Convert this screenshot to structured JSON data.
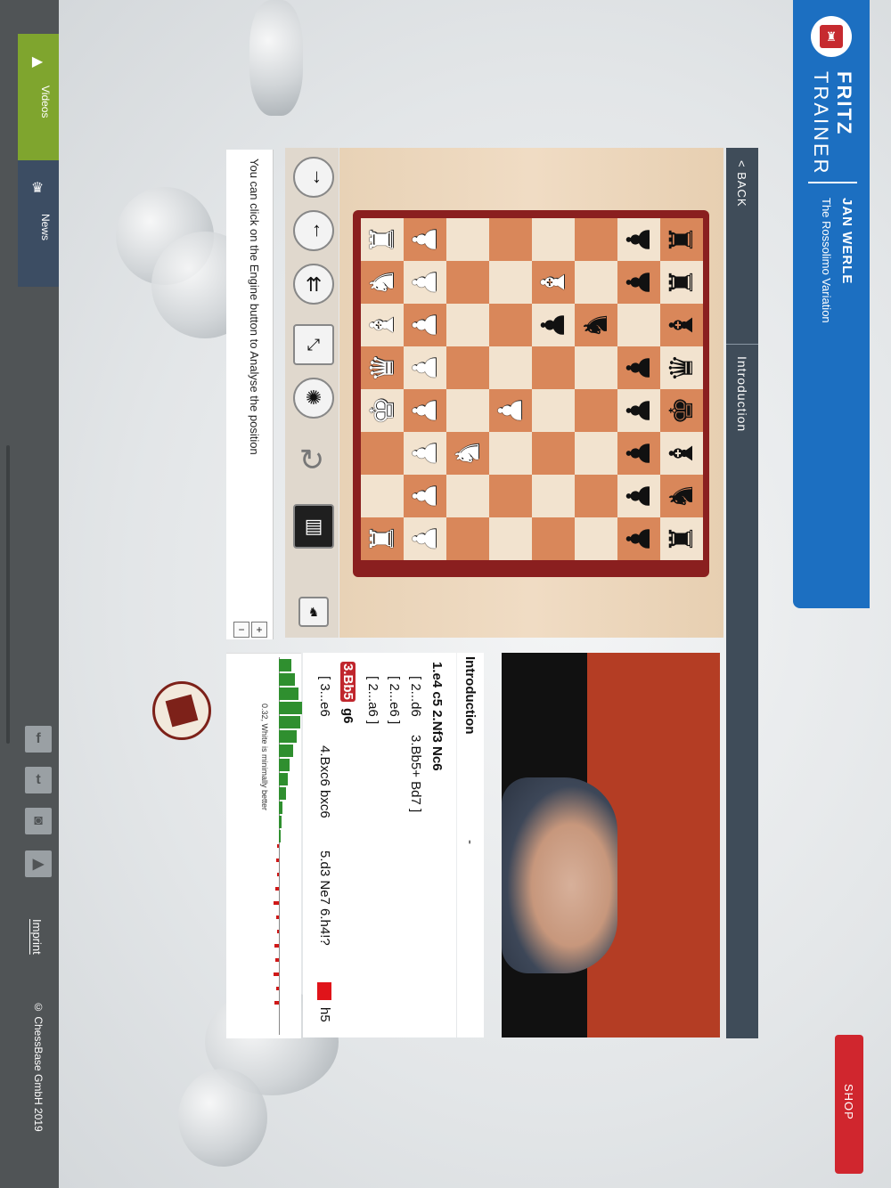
{
  "sidebar": {
    "videos_label": "Videos",
    "news_label": "News",
    "imprint_label": "Imprint",
    "copyright": "© ChessBase GmbH 2019",
    "social": [
      "facebook-icon",
      "twitter-icon",
      "instagram-icon",
      "youtube-icon"
    ],
    "accent_color": "#7fa52e"
  },
  "header": {
    "brand_line1": "FRITZ",
    "brand_line2": "TRAINER",
    "author": "JAN WERLE",
    "course": "The Rossolimo Variation",
    "brand_color": "#1c6fc1",
    "shop_label": "SHOP"
  },
  "nav": {
    "back_label": "< BACK",
    "chapter": "Introduction"
  },
  "board": {
    "light": "#f2e3cf",
    "dark": "#d9875a",
    "pieces": [
      [
        "♖",
        "♙",
        "",
        "",
        "",
        "",
        "♟",
        "♜"
      ],
      [
        "♘",
        "♙",
        "",
        "",
        "♗",
        "",
        "♟",
        "♜_"
      ],
      [
        "♗",
        "♙",
        "",
        "",
        "♟",
        "♞",
        "",
        "♝"
      ],
      [
        "♕",
        "♙",
        "",
        "",
        "",
        "",
        "♟",
        "♛"
      ],
      [
        "♔",
        "♙",
        "",
        "♙",
        "",
        "",
        "♟",
        "♚"
      ],
      [
        "",
        "♙",
        "♘",
        "",
        "",
        "",
        "♟",
        "♝"
      ],
      [
        "",
        "♙",
        "",
        "",
        "",
        "",
        "♟",
        "♞"
      ],
      [
        "♖",
        "♙",
        "",
        "",
        "",
        "",
        "♟",
        "♜"
      ]
    ]
  },
  "info": {
    "message": "You can click on the Engine button to Analyse the position"
  },
  "notation": {
    "title": "Introduction",
    "dash": "-",
    "line1": "1.e4  c5  2.Nf3  Nc6",
    "line2a": "[ 2...d6",
    "line2b": "3.Bb5+  Bd7 ]",
    "line3": "[ 2...e6 ]",
    "line4": "[ 2...a6 ]",
    "current": "3.Bb5",
    "line5b": "g6",
    "line6a": "[ 3...e6",
    "line6b": "4.Bxc6  bxc6",
    "line6c": "5.d3  Ne7  6.h4!?",
    "line6d": "h5"
  },
  "engine": {
    "eval_text": "0.32, White is minimally better"
  }
}
